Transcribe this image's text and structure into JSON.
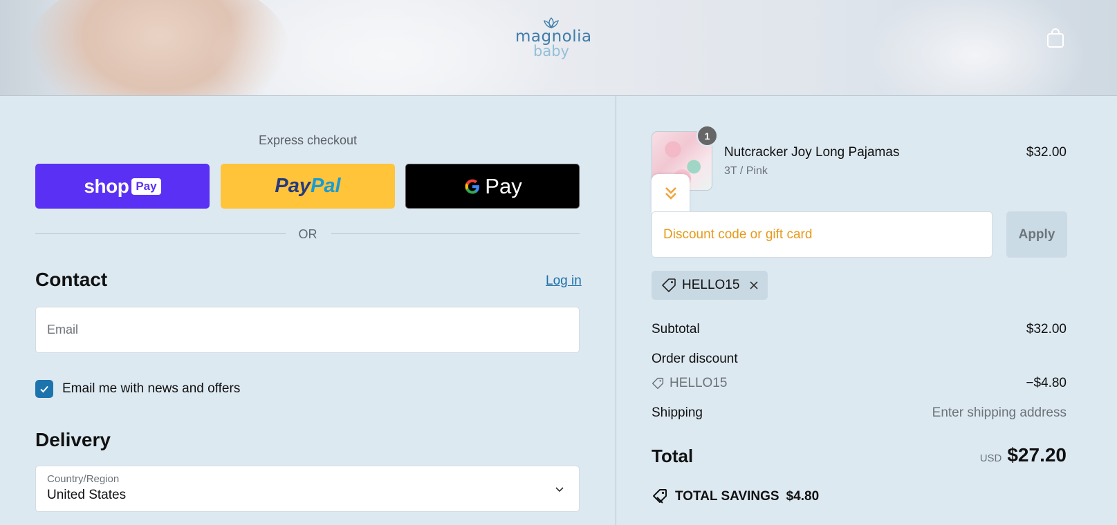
{
  "header": {
    "logo_line1": "magnolia",
    "logo_line2": "baby",
    "cart_icon": "shopping-bag-icon"
  },
  "express": {
    "label": "Express checkout",
    "shop_word": "shop",
    "shop_pay": "Pay",
    "paypal_part1": "Pay",
    "paypal_part2": "Pal",
    "gpay_word": "Pay",
    "or": "OR"
  },
  "contact": {
    "heading": "Contact",
    "login": "Log in",
    "email_placeholder": "Email",
    "newsletter_checked": true,
    "newsletter_label": "Email me with news and offers"
  },
  "delivery": {
    "heading": "Delivery",
    "country_label": "Country/Region",
    "country_value": "United States"
  },
  "order": {
    "item": {
      "name": "Nutcracker Joy Long Pajamas",
      "variant": "3T / Pink",
      "price": "$32.00",
      "quantity": "1"
    },
    "discount_placeholder": "Discount code or gift card",
    "apply": "Apply",
    "applied_code": "HELLO15",
    "subtotal_label": "Subtotal",
    "subtotal_value": "$32.00",
    "order_discount_label": "Order discount",
    "discount_code": "HELLO15",
    "discount_value": "−$4.80",
    "shipping_label": "Shipping",
    "shipping_value": "Enter shipping address",
    "total_label": "Total",
    "currency": "USD",
    "total_value": "$27.20",
    "savings_label": "TOTAL SAVINGS",
    "savings_value": "$4.80"
  },
  "colors": {
    "background": "#dde9f1",
    "shop_pay": "#5a31f4",
    "paypal": "#ffc439",
    "link": "#1b6fa8",
    "checkbox": "#1d74ad",
    "discount_placeholder": "#e69a19"
  }
}
